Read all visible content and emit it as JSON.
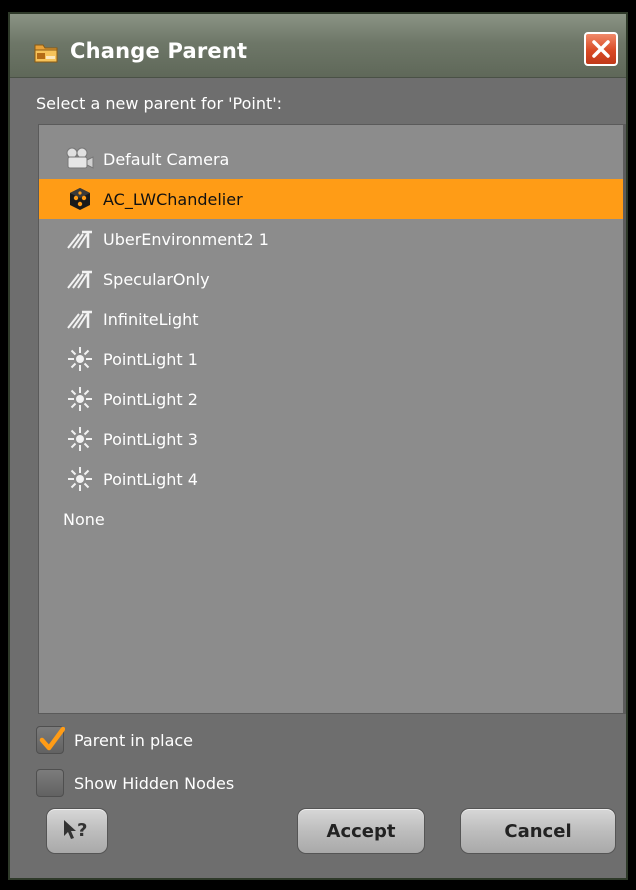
{
  "window": {
    "title": "Change Parent",
    "app_icon": "folder-app-icon",
    "close_icon": "close-icon"
  },
  "prompt": "Select a new parent for 'Point':",
  "items": [
    {
      "label": "Default Camera",
      "icon": "camera-icon",
      "selected": false
    },
    {
      "label": "AC_LWChandelier",
      "icon": "figure-cube-icon",
      "selected": true
    },
    {
      "label": "UberEnvironment2 1",
      "icon": "distant-light-icon",
      "selected": false
    },
    {
      "label": "SpecularOnly",
      "icon": "distant-light-icon",
      "selected": false
    },
    {
      "label": "InfiniteLight",
      "icon": "distant-light-icon",
      "selected": false
    },
    {
      "label": "PointLight 1",
      "icon": "point-light-icon",
      "selected": false
    },
    {
      "label": "PointLight 2",
      "icon": "point-light-icon",
      "selected": false
    },
    {
      "label": "PointLight 3",
      "icon": "point-light-icon",
      "selected": false
    },
    {
      "label": "PointLight 4",
      "icon": "point-light-icon",
      "selected": false
    },
    {
      "label": "None",
      "icon": "",
      "selected": false
    }
  ],
  "options": {
    "parent_in_place": {
      "label": "Parent in place",
      "checked": true
    },
    "show_hidden": {
      "label": "Show Hidden Nodes",
      "checked": false
    }
  },
  "buttons": {
    "help_icon": "help-pointer-icon",
    "accept": "Accept",
    "cancel": "Cancel"
  },
  "colors": {
    "selection": "#ff9c16",
    "list_bg": "#8c8c8c",
    "dialog_bg": "#6e6e6e",
    "close_button": "#d94a25"
  }
}
